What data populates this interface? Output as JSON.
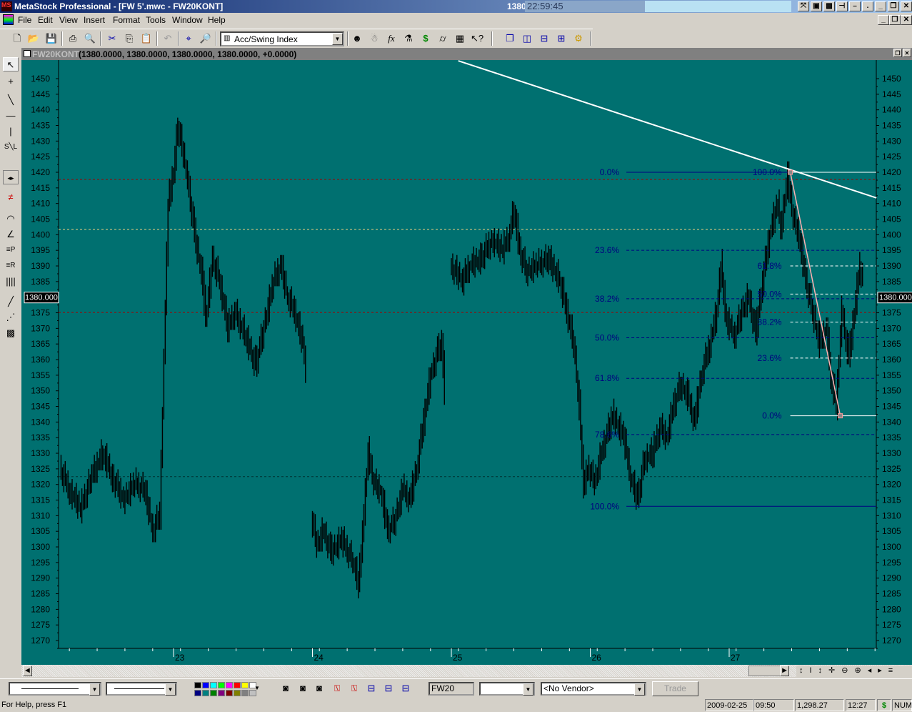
{
  "window": {
    "title": "MetaStock Professional - [FW 5'.mwc - FW20KONT]",
    "price": "1380.0000",
    "clock": "22:59:45"
  },
  "menu": [
    "File",
    "Edit",
    "View",
    "Insert",
    "Format",
    "Tools",
    "Window",
    "Help"
  ],
  "toolbar": {
    "indicator_select": "Acc/Swing Index"
  },
  "chart_window": {
    "symbol": "FW20KONT",
    "values": "(1380.0000, 1380.0000, 1380.0000, 1380.0000, +0.0000)"
  },
  "bottom_bar": {
    "symbol_field": "FW20",
    "vendor_select": "<No Vendor>",
    "trade_label": "Trade"
  },
  "status": {
    "help": "For Help, press F1",
    "date": "2009-02-25",
    "time": "09:50",
    "value": "1,298.27",
    "clock": "12:27",
    "currency": "$",
    "num": "NUM"
  },
  "colors": {
    "background": "#007070",
    "bars": "#000000",
    "fib_left": "#000080",
    "fib_right": "#ffffff",
    "trendline": "#ffffff"
  },
  "chart_data": {
    "type": "bar",
    "y_ticks": [
      1450,
      1445,
      1440,
      1435,
      1430,
      1425,
      1420,
      1415,
      1410,
      1405,
      1400,
      1395,
      1390,
      1385,
      1380,
      1375,
      1370,
      1365,
      1360,
      1355,
      1350,
      1345,
      1340,
      1335,
      1330,
      1325,
      1320,
      1315,
      1310,
      1305,
      1300,
      1295,
      1290,
      1285,
      1280,
      1275,
      1270
    ],
    "ylim": [
      1270,
      1450
    ],
    "x_ticks": [
      23,
      24,
      25,
      26,
      27
    ],
    "xlim": [
      22.17,
      28.06
    ],
    "current_price_label": "1380.000",
    "current_price": 1380,
    "price_path": [
      [
        22.19,
        1325
      ],
      [
        22.26,
        1318
      ],
      [
        22.34,
        1312
      ],
      [
        22.42,
        1322
      ],
      [
        22.5,
        1330
      ],
      [
        22.57,
        1322
      ],
      [
        22.65,
        1315
      ],
      [
        22.73,
        1320
      ],
      [
        22.8,
        1318
      ],
      [
        22.86,
        1305
      ],
      [
        22.91,
        1310
      ],
      [
        22.94,
        1360
      ],
      [
        22.97,
        1410
      ],
      [
        23.01,
        1420
      ],
      [
        23.04,
        1435
      ],
      [
        23.08,
        1425
      ],
      [
        23.11,
        1418
      ],
      [
        23.16,
        1400
      ],
      [
        23.22,
        1385
      ],
      [
        23.24,
        1372
      ],
      [
        23.29,
        1392
      ],
      [
        23.34,
        1385
      ],
      [
        23.4,
        1370
      ],
      [
        23.45,
        1375
      ],
      [
        23.52,
        1368
      ],
      [
        23.6,
        1358
      ],
      [
        23.65,
        1368
      ],
      [
        23.73,
        1385
      ],
      [
        23.78,
        1390
      ],
      [
        23.83,
        1380
      ],
      [
        23.88,
        1375
      ],
      [
        23.94,
        1365
      ],
      [
        23.96,
        1355
      ],
      [
        null,
        null
      ],
      [
        24.0,
        1310
      ],
      [
        24.04,
        1300
      ],
      [
        24.09,
        1305
      ],
      [
        24.14,
        1298
      ],
      [
        24.22,
        1302
      ],
      [
        24.3,
        1295
      ],
      [
        24.34,
        1288
      ],
      [
        24.37,
        1305
      ],
      [
        24.41,
        1330
      ],
      [
        24.45,
        1320
      ],
      [
        24.5,
        1318
      ],
      [
        24.55,
        1305
      ],
      [
        24.6,
        1308
      ],
      [
        24.66,
        1318
      ],
      [
        24.71,
        1315
      ],
      [
        24.76,
        1325
      ],
      [
        24.81,
        1340
      ],
      [
        24.86,
        1355
      ],
      [
        24.91,
        1362
      ],
      [
        24.94,
        1365
      ],
      [
        24.96,
        1350
      ],
      [
        null,
        null
      ],
      [
        25.0,
        1390
      ],
      [
        25.04,
        1388
      ],
      [
        25.09,
        1385
      ],
      [
        25.14,
        1390
      ],
      [
        25.22,
        1392
      ],
      [
        25.3,
        1398
      ],
      [
        25.38,
        1395
      ],
      [
        25.43,
        1400
      ],
      [
        25.46,
        1408
      ],
      [
        25.5,
        1395
      ],
      [
        25.55,
        1388
      ],
      [
        25.63,
        1390
      ],
      [
        25.71,
        1392
      ],
      [
        25.79,
        1385
      ],
      [
        25.84,
        1375
      ],
      [
        25.89,
        1365
      ],
      [
        25.93,
        1345
      ],
      [
        25.96,
        1320
      ],
      [
        26.0,
        1325
      ],
      [
        26.04,
        1320
      ],
      [
        26.09,
        1330
      ],
      [
        26.17,
        1342
      ],
      [
        26.25,
        1335
      ],
      [
        26.3,
        1322
      ],
      [
        26.35,
        1315
      ],
      [
        26.4,
        1328
      ],
      [
        26.46,
        1330
      ],
      [
        26.51,
        1338
      ],
      [
        26.56,
        1335
      ],
      [
        26.61,
        1345
      ],
      [
        26.66,
        1352
      ],
      [
        26.71,
        1348
      ],
      [
        26.76,
        1340
      ],
      [
        26.81,
        1355
      ],
      [
        26.87,
        1365
      ],
      [
        26.92,
        1375
      ],
      [
        26.95,
        1390
      ],
      [
        26.99,
        1372
      ],
      [
        27.05,
        1368
      ],
      [
        27.1,
        1375
      ],
      [
        27.15,
        1380
      ],
      [
        27.2,
        1368
      ],
      [
        27.25,
        1385
      ],
      [
        27.3,
        1400
      ],
      [
        27.36,
        1410
      ],
      [
        27.38,
        1402
      ],
      [
        27.43,
        1418
      ],
      [
        27.47,
        1405
      ],
      [
        27.51,
        1400
      ],
      [
        27.56,
        1385
      ],
      [
        27.61,
        1375
      ],
      [
        27.66,
        1365
      ],
      [
        27.71,
        1370
      ],
      [
        27.74,
        1355
      ],
      [
        27.78,
        1345
      ],
      [
        27.82,
        1375
      ],
      [
        27.87,
        1360
      ],
      [
        27.91,
        1375
      ],
      [
        27.95,
        1390
      ],
      [
        27.97,
        1385
      ]
    ],
    "trendline": [
      [
        25.05,
        1455.7
      ],
      [
        28.06,
        1411.8
      ]
    ],
    "horizontal_lines": [
      {
        "price": 1417.7,
        "color": "#a00000"
      },
      {
        "price": 1401.7,
        "color": "#f0d080"
      },
      {
        "price": 1375.1,
        "color": "#a00000"
      },
      {
        "price": 1322.5,
        "color": "#003030"
      }
    ],
    "fib_left": {
      "start": 26.26,
      "levels": [
        {
          "label": "0.0%",
          "price": 1420,
          "solid": true
        },
        {
          "label": "23.6%",
          "price": 1395
        },
        {
          "label": "38.2%",
          "price": 1379.5
        },
        {
          "label": "50.0%",
          "price": 1367
        },
        {
          "label": "61.8%",
          "price": 1354
        },
        {
          "label": "78.6%",
          "price": 1336
        },
        {
          "label": "100.0%",
          "price": 1313,
          "solid": true
        }
      ]
    },
    "fib_right": {
      "start": 27.44,
      "from": [
        27.44,
        1420
      ],
      "to": [
        27.8,
        1342
      ],
      "levels": [
        {
          "label": "100.0%",
          "price": 1420,
          "solid": true
        },
        {
          "label": "61.8%",
          "price": 1390
        },
        {
          "label": "50.0%",
          "price": 1381
        },
        {
          "label": "38.2%",
          "price": 1372
        },
        {
          "label": "23.6%",
          "price": 1360.5
        },
        {
          "label": "0.0%",
          "price": 1342,
          "solid": true
        }
      ]
    }
  }
}
